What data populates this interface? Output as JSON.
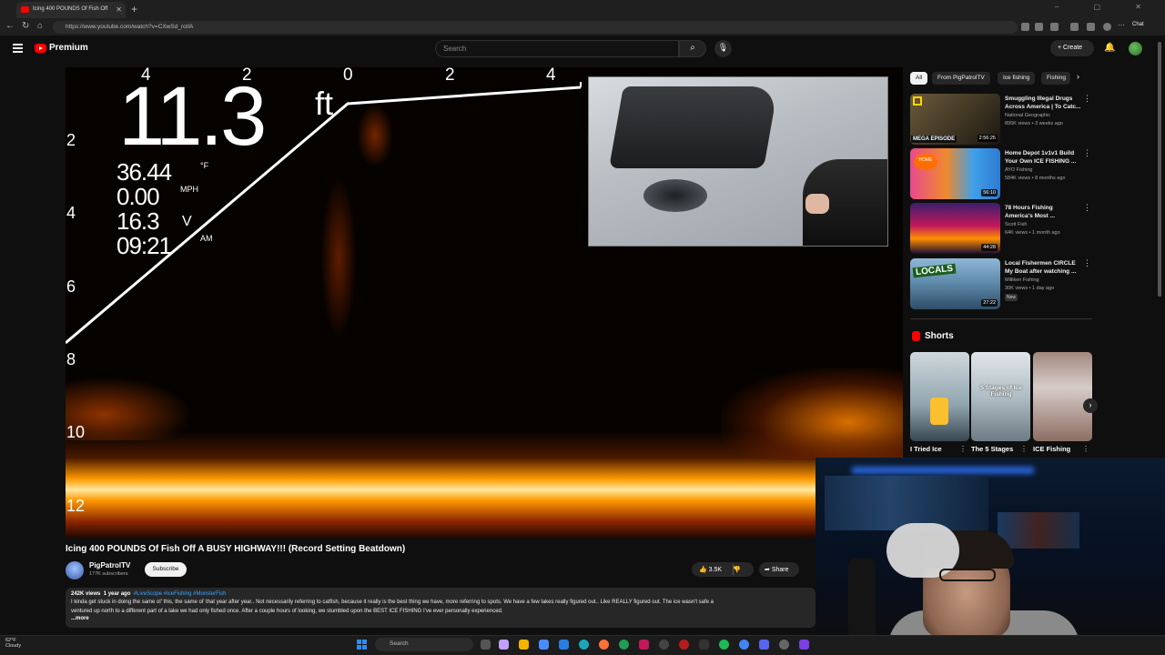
{
  "browser": {
    "tab_title": "Icing 400 POUNDS Of Fish Off",
    "url": "https://www.youtube.com/watch?v=CXwSd_roIlA",
    "chat_label": "Chat",
    "new_tab": "+",
    "window_controls": "– ▢ ✕"
  },
  "header": {
    "brand": "Premium",
    "search_placeholder": "Search",
    "create_label": "Create"
  },
  "player": {
    "depth_value": "11.3",
    "depth_unit": "ft",
    "water_temp": "36.44",
    "water_temp_unit": "°F",
    "speed": "0.00",
    "speed_unit": "MPH",
    "voltage": "16.3",
    "voltage_unit": "V",
    "time": "09:21",
    "time_unit": "AM",
    "top_scale": [
      "4",
      "2",
      "0",
      "2",
      "4"
    ],
    "depth_scale": [
      "2",
      "4",
      "6",
      "8",
      "10",
      "12"
    ]
  },
  "video": {
    "title": "Icing 400 POUNDS Of Fish Off A BUSY HIGHWAY!!! (Record Setting Beatdown)",
    "channel": "PigPatrolTV",
    "subscribers": "177K subscribers",
    "subscribe_label": "Subscribe",
    "likes": "3.5K",
    "share_label": "Share",
    "views": "242K views",
    "age": "1 year ago",
    "tags": "#LiveScope #IceFishing #MonsterFish",
    "description_line1": "I kinda get stuck in doing the same ol' this, the same ol' that year after year.. Not necessarily referring to catfish, because it really is the best thing we have, more referring to spots. We have a few lakes really figured out.. Like REALLY figured out. The ice wasn't safe a",
    "description_line2": "ventured up north to a different part of a lake we had only fished once. After a couple hours of looking, we stumbled upon the BEST ICE FISHING I've ever personally experienced.",
    "more_label": "...more"
  },
  "chips": [
    "All",
    "From PigPatrolTV",
    "Ice fishing",
    "Fishing"
  ],
  "recommendations": [
    {
      "title": "Smuggling Illegal Drugs Across America | To Catc...",
      "channel": "National Geographic",
      "meta": "895K views • 3 weeks ago",
      "duration": "2:56:25",
      "overlay": "MEGA EPISODE",
      "badge": ""
    },
    {
      "title": "Home Depot 1v1v1 Build Your Own ICE FISHING ...",
      "channel": "AYO Fishing",
      "meta": "584K views • 8 months ago",
      "duration": "56:10",
      "overlay": "",
      "badge": ""
    },
    {
      "title": "78 Hours Fishing America's Most ...",
      "channel": "Scott Fish",
      "meta": "64K views • 1 month ago",
      "duration": "44:28",
      "overlay": "",
      "badge": ""
    },
    {
      "title": "Local Fishermen CIRCLE My Boat after watching ...",
      "channel": "Milliken Fishing",
      "meta": "30K views • 1 day ago",
      "duration": "27:22",
      "overlay": "LOCALS",
      "badge": "New"
    }
  ],
  "shorts": {
    "heading": "Shorts",
    "items": [
      {
        "title": "I Tried Ice"
      },
      {
        "title": "The 5 Stages",
        "overlay": "5 Stages of Ice Fishing"
      },
      {
        "title": "ICE Fishing"
      }
    ]
  },
  "taskbar": {
    "weather_temp": "62°F",
    "weather_desc": "Cloudy",
    "search_label": "Search"
  },
  "colors": {
    "youtube_red": "#ff0000",
    "background": "#0f0f0f",
    "link_blue": "#3ea6ff"
  }
}
